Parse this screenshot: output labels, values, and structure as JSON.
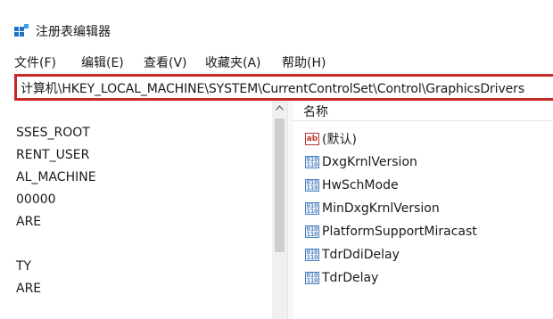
{
  "window": {
    "title": "注册表编辑器"
  },
  "menu": [
    "文件(F)",
    "编辑(E)",
    "查看(V)",
    "收藏夹(A)",
    "帮助(H)"
  ],
  "address": {
    "path": "计算机\\HKEY_LOCAL_MACHINE\\SYSTEM\\CurrentControlSet\\Control\\GraphicsDrivers"
  },
  "tree": [
    "SSES_ROOT",
    "RENT_USER",
    "AL_MACHINE",
    "00000",
    "ARE",
    "TY",
    "ARE"
  ],
  "values_pane": {
    "column_header": "名称",
    "rows": [
      {
        "name": "(默认)",
        "icon": "string-value-icon"
      },
      {
        "name": "DxgKrnlVersion",
        "icon": "binary-value-icon"
      },
      {
        "name": "HwSchMode",
        "icon": "binary-value-icon"
      },
      {
        "name": "MinDxgKrnlVersion",
        "icon": "binary-value-icon"
      },
      {
        "name": "PlatformSupportMiracast",
        "icon": "binary-value-icon"
      },
      {
        "name": "TdrDdiDelay",
        "icon": "binary-value-icon"
      },
      {
        "name": "TdrDelay",
        "icon": "binary-value-icon"
      }
    ]
  },
  "colors": {
    "highlight_border": "#c62828",
    "icon_blue": "#2a5ea8"
  }
}
